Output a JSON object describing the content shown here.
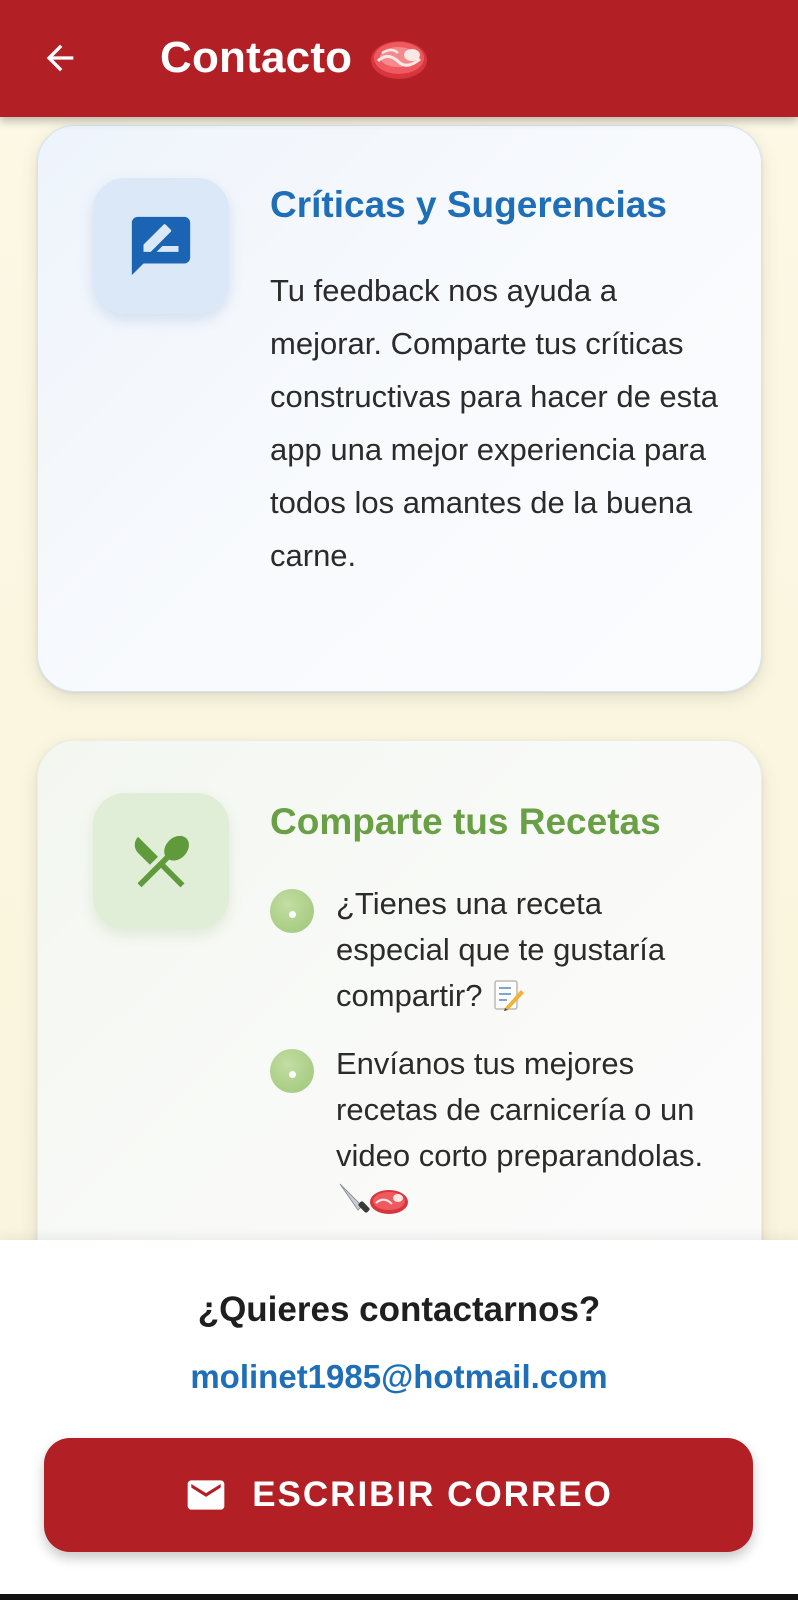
{
  "app_bar": {
    "title": "Contacto",
    "back_icon": "arrow-left-icon",
    "title_emoji": "meat-emoji",
    "color": "#b21f24"
  },
  "feedback_card": {
    "icon": "rate-review-icon",
    "title": "Críticas y Sugerencias",
    "body": "Tu feedback nos ayuda a mejorar. Comparte tus críticas constructivas para hacer de esta app una mejor experiencia para todos los amantes de la buena carne.",
    "accent": "#1f6fb8"
  },
  "recipes_card": {
    "icon": "restaurant-icon",
    "title": "Comparte tus Recetas",
    "accent": "#6aa045",
    "bullets": [
      {
        "text": "¿Tienes una receta especial que te gustaría compartir?",
        "emoji": "memo-emoji"
      },
      {
        "text": "Envíanos tus mejores recetas de carnicería o un video corto preparandolas.",
        "emoji": "knife-meat-emoji"
      }
    ]
  },
  "contact": {
    "question": "¿Quieres contactarnos?",
    "email": "molinet1985@hotmail.com",
    "button_label": "ESCRIBIR CORREO",
    "button_icon": "mail-icon"
  }
}
